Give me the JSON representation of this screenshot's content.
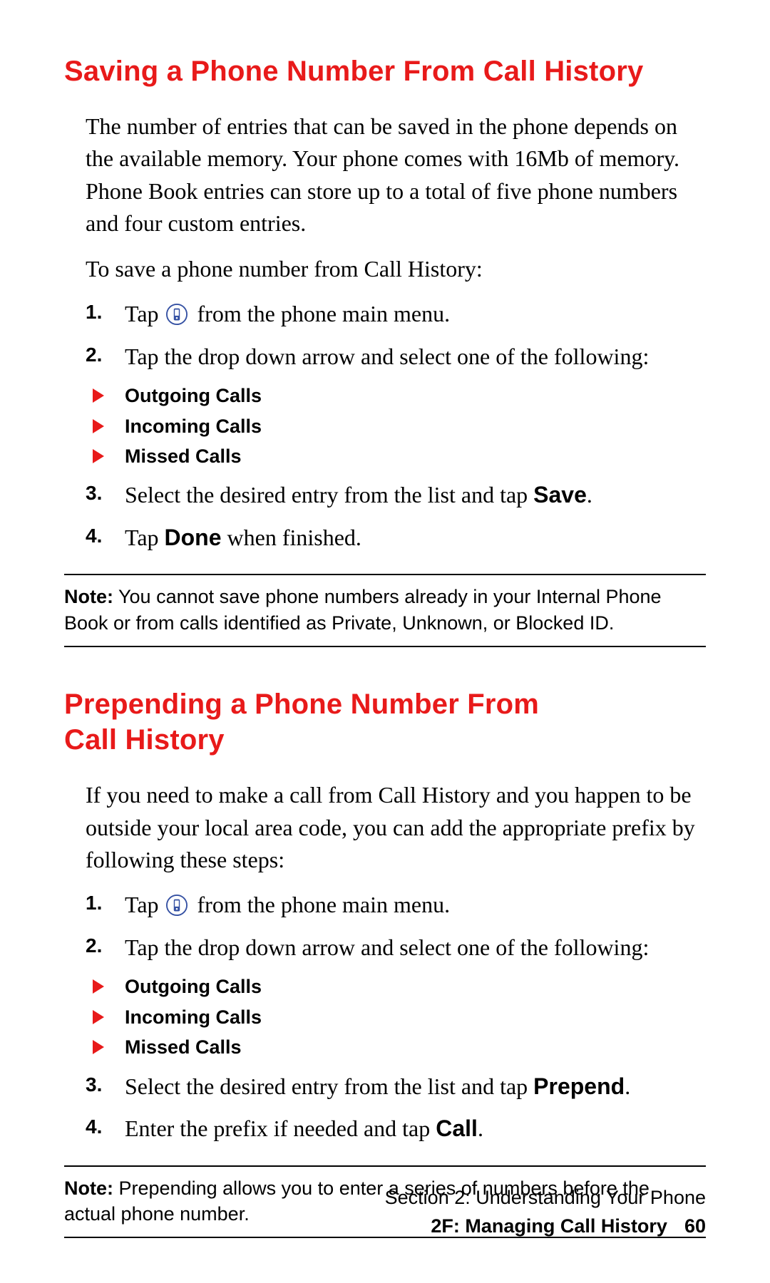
{
  "section1": {
    "heading": "Saving a Phone Number From Call History",
    "para1": "The number of entries that can be saved in the phone depends on the available memory. Your phone comes with 16Mb of memory. Phone Book entries can store up to a total of five phone numbers and four custom entries.",
    "para2": "To save a phone number from Call History:",
    "step1_num": "1.",
    "step1_a": "Tap ",
    "step1_b": " from the phone main menu.",
    "step2_num": "2.",
    "step2": "Tap the drop down arrow and select one of the following:",
    "bullets": {
      "b1": "Outgoing Calls",
      "b2": "Incoming Calls",
      "b3": "Missed Calls"
    },
    "step3_num": "3.",
    "step3_a": "Select the desired entry from the list and tap ",
    "step3_bold": "Save",
    "step3_b": ".",
    "step4_num": "4.",
    "step4_a": "Tap ",
    "step4_bold": "Done",
    "step4_b": " when finished.",
    "note_label": "Note:",
    "note_text": " You cannot save phone numbers already in your Internal Phone Book or from calls identified as Private, Unknown, or Blocked ID."
  },
  "section2": {
    "heading": "Prepending a Phone Number From Call History",
    "para1": "If you need to make a call from Call History and you happen to be outside your local area code, you can add the appropriate prefix by following these steps:",
    "step1_num": "1.",
    "step1_a": "Tap ",
    "step1_b": " from the phone main menu.",
    "step2_num": "2.",
    "step2": "Tap the drop down arrow and select one of the following:",
    "bullets": {
      "b1": "Outgoing Calls",
      "b2": "Incoming Calls",
      "b3": "Missed Calls"
    },
    "step3_num": "3.",
    "step3_a": "Select the desired entry from the list and tap ",
    "step3_bold": "Prepend",
    "step3_b": ".",
    "step4_num": "4.",
    "step4_a": "Enter the prefix if needed and tap ",
    "step4_bold": "Call",
    "step4_b": ".",
    "note_label": "Note:",
    "note_text": " Prepending allows you to enter a series of numbers before the actual phone number."
  },
  "footer": {
    "line1": "Section 2: Understanding Your Phone",
    "line2_label": "2F: Managing Call History",
    "page_number": "60"
  }
}
